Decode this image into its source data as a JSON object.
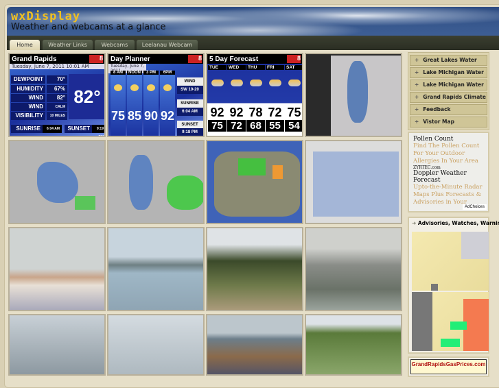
{
  "site": {
    "title": "wxDisplay",
    "tagline": "Weather and webcams at a glance"
  },
  "nav": {
    "tabs": [
      {
        "label": "Home",
        "active": true
      },
      {
        "label": "Weather Links"
      },
      {
        "label": "Webcams"
      },
      {
        "label": "Leelanau Webcam"
      }
    ]
  },
  "current": {
    "city": "Grand Rapids",
    "date": "Tuesday, June 7, 2011 10:01 AM",
    "rows": [
      {
        "label": "DEWPOINT",
        "value": "70°"
      },
      {
        "label": "HUMIDITY",
        "value": "67%"
      },
      {
        "label": "WIND CHILL",
        "value": "82°"
      },
      {
        "label": "WIND",
        "value": "CALM"
      },
      {
        "label": "VISIBILITY",
        "value": "10 MILES"
      }
    ],
    "temp": "82°",
    "sunrise_label": "SUNRISE",
    "sunrise": "6:04 AM",
    "sunset_label": "SUNSET",
    "sunset": "9:19 PM"
  },
  "planner": {
    "title": "Day Planner",
    "date": "Tuesday, June 7, 2011",
    "times": [
      "8 AM",
      "NOON",
      "3 PM",
      "6PM"
    ],
    "temps": [
      "75",
      "85",
      "90",
      "92"
    ],
    "wind_label": "WIND",
    "wind": "SW 10-20",
    "sunrise_label": "SUNRISE",
    "sunrise": "6:04 AM",
    "sunset_label": "SUNSET",
    "sunset": "9:18 PM"
  },
  "forecast": {
    "title": "5 Day Forecast",
    "days": [
      "TUE",
      "WED",
      "THU",
      "FRI",
      "SAT"
    ],
    "highs": [
      "92",
      "92",
      "78",
      "72",
      "75"
    ],
    "lows": [
      "75",
      "72",
      "68",
      "55",
      "54"
    ]
  },
  "brand": {
    "logo_text": "8"
  },
  "sidebar": {
    "links": [
      "Great Lakes Water",
      "Lake Michigan Water",
      "Lake Michigan Water",
      "Grand Rapids Climate",
      "Feedback",
      "Vistor Map"
    ],
    "ads": {
      "title1": "Pollen Count",
      "desc1": "Find The Pollen Count For Your Outdoor Allergies In Your Area",
      "src1": "ZYRTEC.com",
      "title2": "Doppler Weather Forecast",
      "desc2": "Upto-the-Minute Radar Maps Plus Forecasts & Advisories in Your",
      "adchoices": "AdChoices"
    },
    "advisories_title": "Advisories, Watches, Warning",
    "gas_banner": "GrandRapidsGasPrices.com"
  },
  "colors": {
    "accent": "#f0c020",
    "nav": "#2a2d22",
    "page": "#d9d0b4"
  }
}
